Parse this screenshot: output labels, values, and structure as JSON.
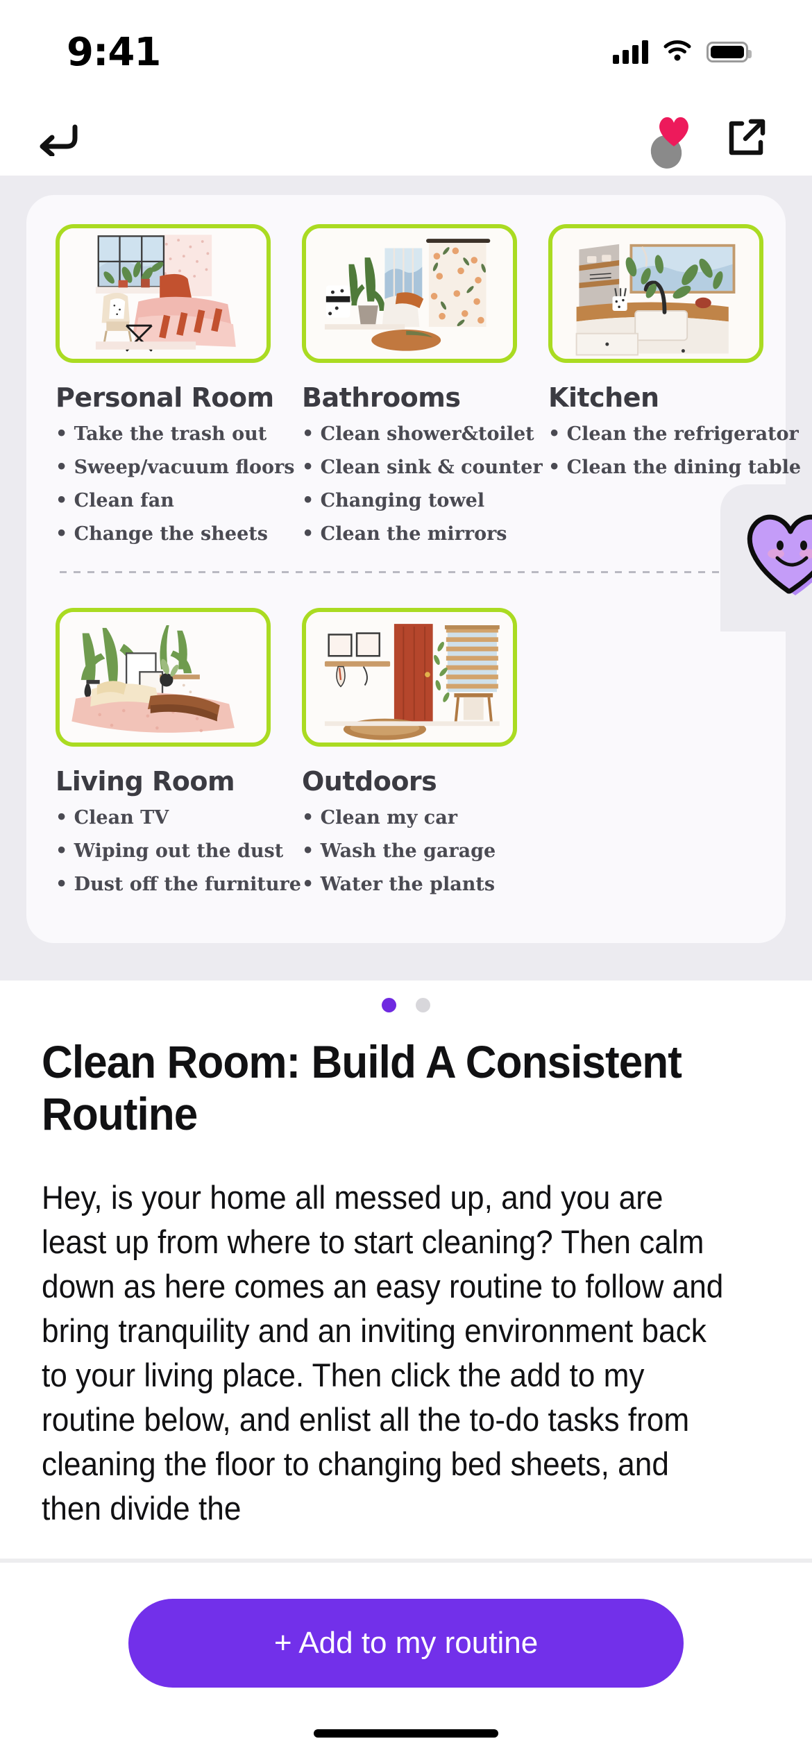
{
  "status_bar": {
    "time": "9:41",
    "signal_icon": "cellular-signal-icon",
    "wifi_icon": "wifi-icon",
    "battery_icon": "battery-icon"
  },
  "nav": {
    "back_icon": "back-arrow-icon",
    "favorite_icon": "heart-icon",
    "favorite_color": "#ed1a5b",
    "share_icon": "share-external-icon"
  },
  "carousel": {
    "active_index": 0,
    "dot_active_color": "#6f2ae0",
    "dot_inactive_color": "#d8d7db",
    "mascot_icon": "smiling-heart-sticker",
    "mascot_color": "#b388f5",
    "thumb_border_color": "#aadb22",
    "categories": [
      {
        "title": "Personal Room",
        "image": "bedroom-illustration",
        "tasks": [
          "Take the trash out",
          "Sweep/vacuum floors",
          "Clean fan",
          "Change the sheets"
        ]
      },
      {
        "title": "Bathrooms",
        "image": "bathroom-illustration",
        "tasks": [
          "Clean shower&toilet",
          "Clean sink & counter",
          "Changing towel",
          "Clean the mirrors"
        ]
      },
      {
        "title": "Kitchen",
        "image": "kitchen-illustration",
        "tasks": [
          "Clean the refrigerator",
          "Clean the dining table"
        ]
      },
      {
        "title": "Living Room",
        "image": "living-room-illustration",
        "tasks": [
          "Clean TV",
          "Wiping out the dust",
          "Dust off the furniture"
        ]
      },
      {
        "title": "Outdoors",
        "image": "outdoors-illustration",
        "tasks": [
          "Clean my car",
          "Wash the garage",
          "Water the plants"
        ]
      }
    ]
  },
  "article": {
    "title": "Clean Room: Build A Consistent Routine",
    "body": "Hey, is your home all messed up, and you are least up from where to start cleaning? Then calm down as here comes an easy routine to follow and bring tranquility and an inviting environment back to your living place.\nThen click the add to my routine below, and enlist all the to-do tasks from cleaning the floor to changing bed sheets, and then divide the"
  },
  "cta": {
    "label": "+ Add to my routine",
    "color": "#7230ea"
  }
}
